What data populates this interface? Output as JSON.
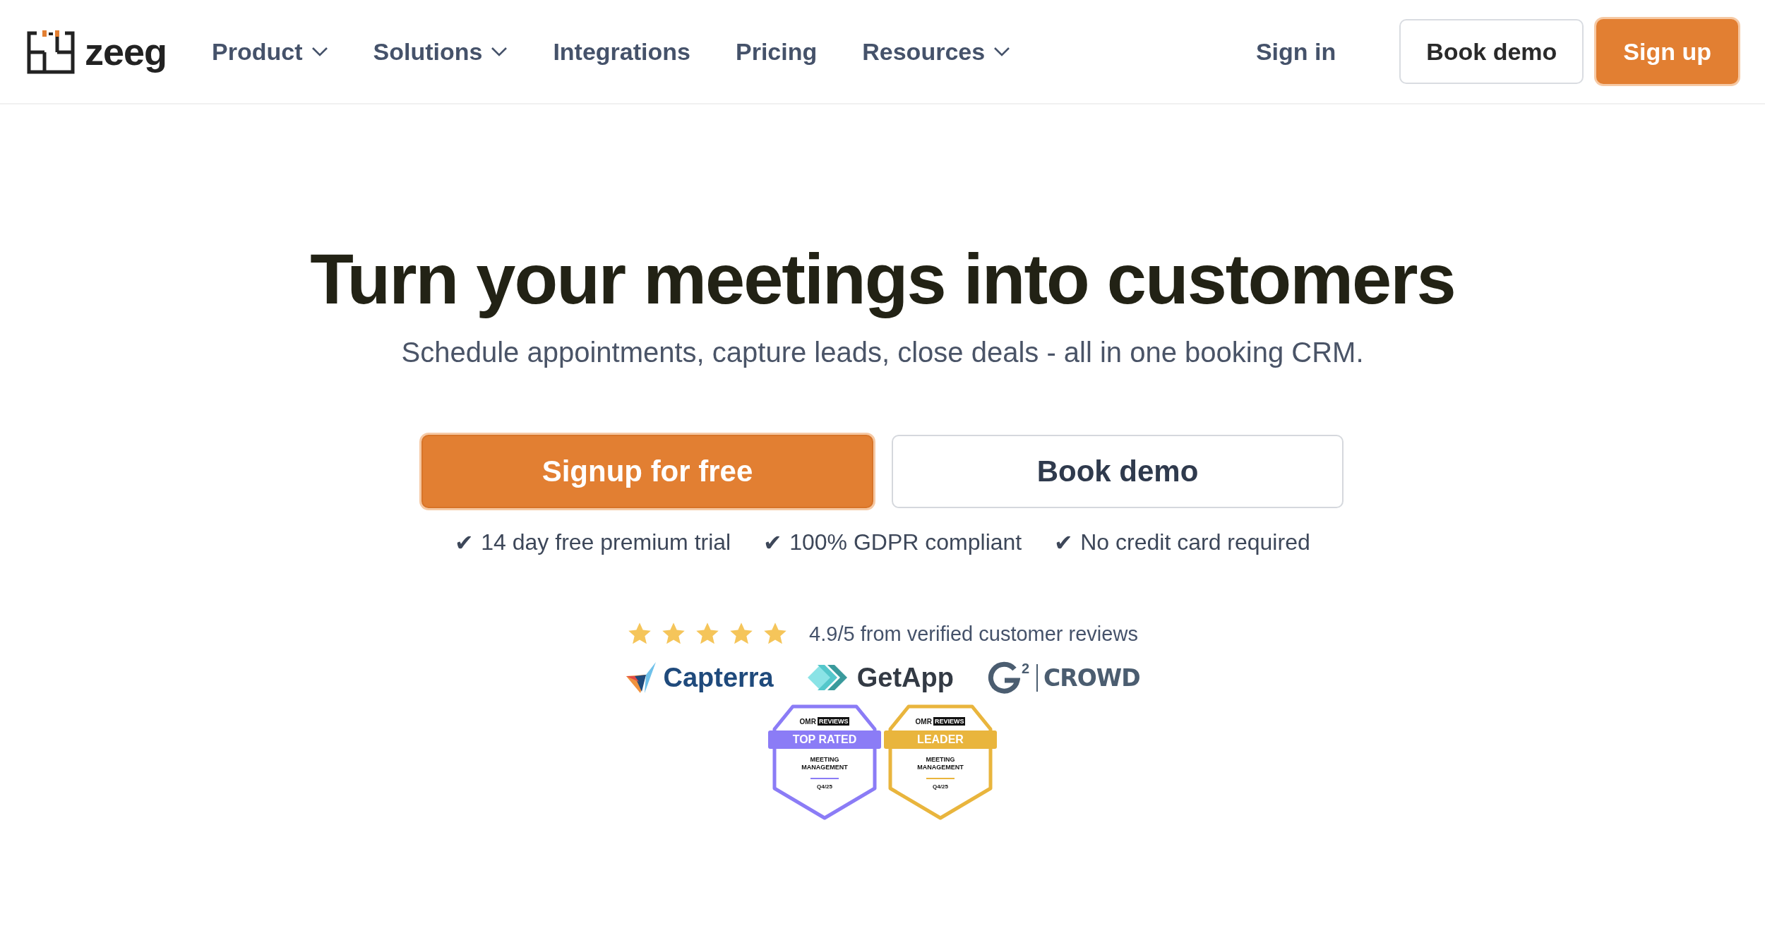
{
  "header": {
    "logo": {
      "text": "zeeg"
    },
    "nav": [
      {
        "label": "Product",
        "dropdown": true
      },
      {
        "label": "Solutions",
        "dropdown": true
      },
      {
        "label": "Integrations",
        "dropdown": false
      },
      {
        "label": "Pricing",
        "dropdown": false
      },
      {
        "label": "Resources",
        "dropdown": true
      }
    ],
    "actions": [
      {
        "label": "Sign in",
        "kind": "link"
      },
      {
        "label": "Book demo",
        "kind": "outline"
      },
      {
        "label": "Sign up",
        "kind": "primary"
      }
    ]
  },
  "hero": {
    "title": "Turn your meetings into customers",
    "subtitle": "Schedule appointments, capture leads, close deals - all in one booking CRM.",
    "buttons": [
      {
        "label": "Signup for free",
        "kind": "primary"
      },
      {
        "label": "Book demo",
        "kind": "outline"
      }
    ],
    "checks": [
      {
        "mark": "✔",
        "text": "14 day free premium trial"
      },
      {
        "mark": "✔",
        "text": "100% GDPR compliant"
      },
      {
        "mark": "✔",
        "text": "No credit card required"
      }
    ]
  },
  "reviews": {
    "stars": 5,
    "text": "4.9/5 from verified customer reviews",
    "logos": [
      {
        "kind": "capterra",
        "name": "Capterra"
      },
      {
        "kind": "getapp",
        "name": "GetApp"
      },
      {
        "kind": "g2",
        "mark": "2",
        "name": "CROWD"
      }
    ],
    "badges": [
      {
        "brand": "OMR",
        "brand_tag": "REVIEWS",
        "ribbon": "TOP RATED",
        "category": "MEETING MANAGEMENT",
        "period": "Q4/25",
        "color": "#8b7cf6"
      },
      {
        "brand": "OMR",
        "brand_tag": "REVIEWS",
        "ribbon": "LEADER",
        "category": "MEETING MANAGEMENT",
        "period": "Q4/25",
        "color": "#e9b53d"
      }
    ]
  }
}
